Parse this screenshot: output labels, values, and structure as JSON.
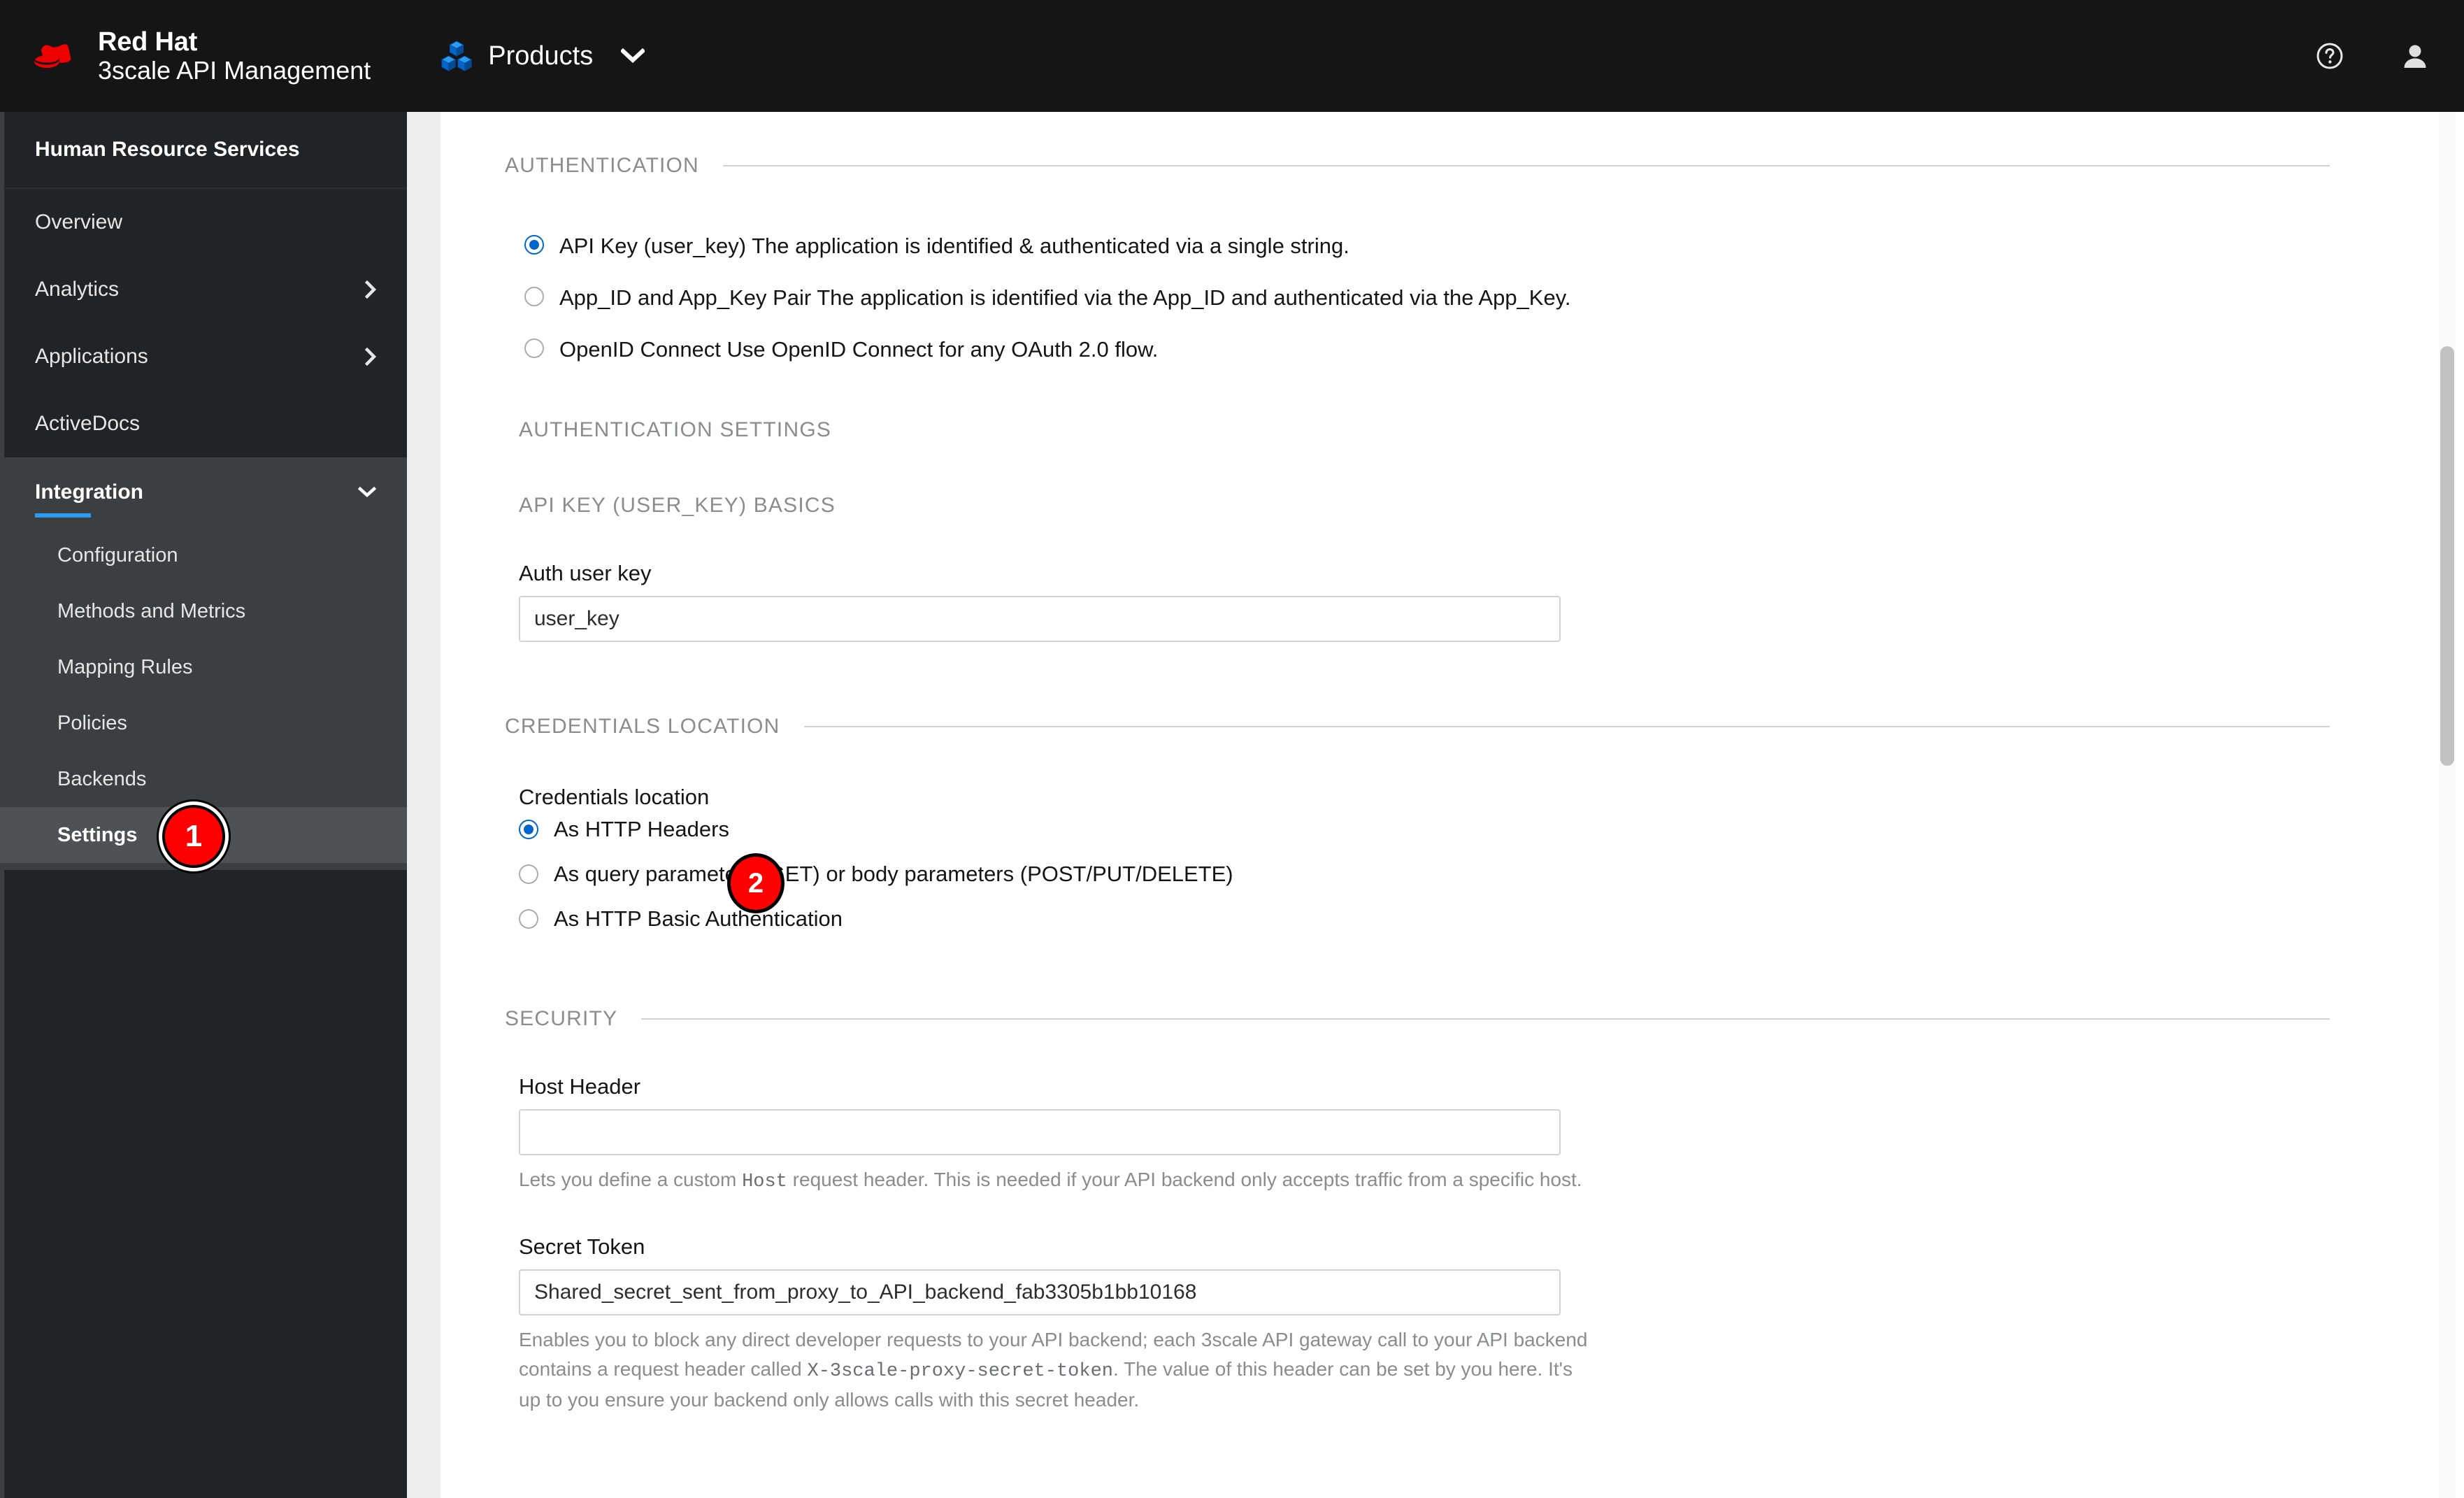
{
  "masthead": {
    "brand_line1": "Red Hat",
    "brand_line2": "3scale API Management",
    "products_label": "Products",
    "help_icon": "help-circle-icon",
    "user_icon": "user-avatar-icon",
    "chevron_icon": "chevron-down-icon",
    "cubes_icon": "cubes-icon",
    "logo_icon": "red-hat-fedora-logo"
  },
  "sidebar": {
    "title": "Human Resource Services",
    "items": [
      {
        "label": "Overview",
        "expandable": false
      },
      {
        "label": "Analytics",
        "expandable": true,
        "chevron": "chevron-right-icon"
      },
      {
        "label": "Applications",
        "expandable": true,
        "chevron": "chevron-right-icon"
      },
      {
        "label": "ActiveDocs",
        "expandable": false
      }
    ],
    "group": {
      "label": "Integration",
      "chevron": "chevron-down-icon"
    },
    "sub_items": [
      {
        "label": "Configuration",
        "active": false
      },
      {
        "label": "Methods and Metrics",
        "active": false
      },
      {
        "label": "Mapping Rules",
        "active": false
      },
      {
        "label": "Policies",
        "active": false
      },
      {
        "label": "Backends",
        "active": false
      },
      {
        "label": "Settings",
        "active": true
      }
    ]
  },
  "main": {
    "authentication": {
      "section_title": "AUTHENTICATION",
      "options": [
        {
          "label": "API Key (user_key) The application is identified & authenticated via a single string.",
          "selected": true
        },
        {
          "label": "App_ID and App_Key Pair The application is identified via the App_ID and authenticated via the App_Key.",
          "selected": false
        },
        {
          "label": "OpenID Connect Use OpenID Connect for any OAuth 2.0 flow.",
          "selected": false
        }
      ]
    },
    "auth_settings": {
      "section_title": "AUTHENTICATION SETTINGS",
      "basics_title": "API KEY (USER_KEY) BASICS",
      "auth_user_key": {
        "label": "Auth user key",
        "value": "user_key"
      }
    },
    "credentials_location": {
      "section_title": "CREDENTIALS LOCATION",
      "label": "Credentials location",
      "options": [
        {
          "label": "As HTTP Headers",
          "selected": true
        },
        {
          "label": "As query parameters (GET) or body parameters (POST/PUT/DELETE)",
          "selected": false
        },
        {
          "label": "As HTTP Basic Authentication",
          "selected": false
        }
      ]
    },
    "security": {
      "section_title": "SECURITY",
      "host_header": {
        "label": "Host Header",
        "value": "",
        "help_pre": "Lets you define a custom ",
        "help_code": "Host",
        "help_post": " request header. This is needed if your API backend only accepts traffic from a specific host."
      },
      "secret_token": {
        "label": "Secret Token",
        "value": "Shared_secret_sent_from_proxy_to_API_backend_fab3305b1bb10168",
        "help_pre": "Enables you to block any direct developer requests to your API backend; each 3scale API gateway call to your API backend contains a request header called ",
        "help_code": "X-3scale-proxy-secret-token",
        "help_post": ". The value of this header can be set by you here. It's up to you ensure your backend only allows calls with this secret header."
      }
    }
  },
  "annotations": {
    "badge_1": "1",
    "badge_2": "2"
  },
  "colors": {
    "brand_red": "#ee0000",
    "accent_blue": "#06c",
    "badge_red": "#ff0000",
    "masthead_bg": "#151515",
    "sidebar_bg": "#212427"
  }
}
